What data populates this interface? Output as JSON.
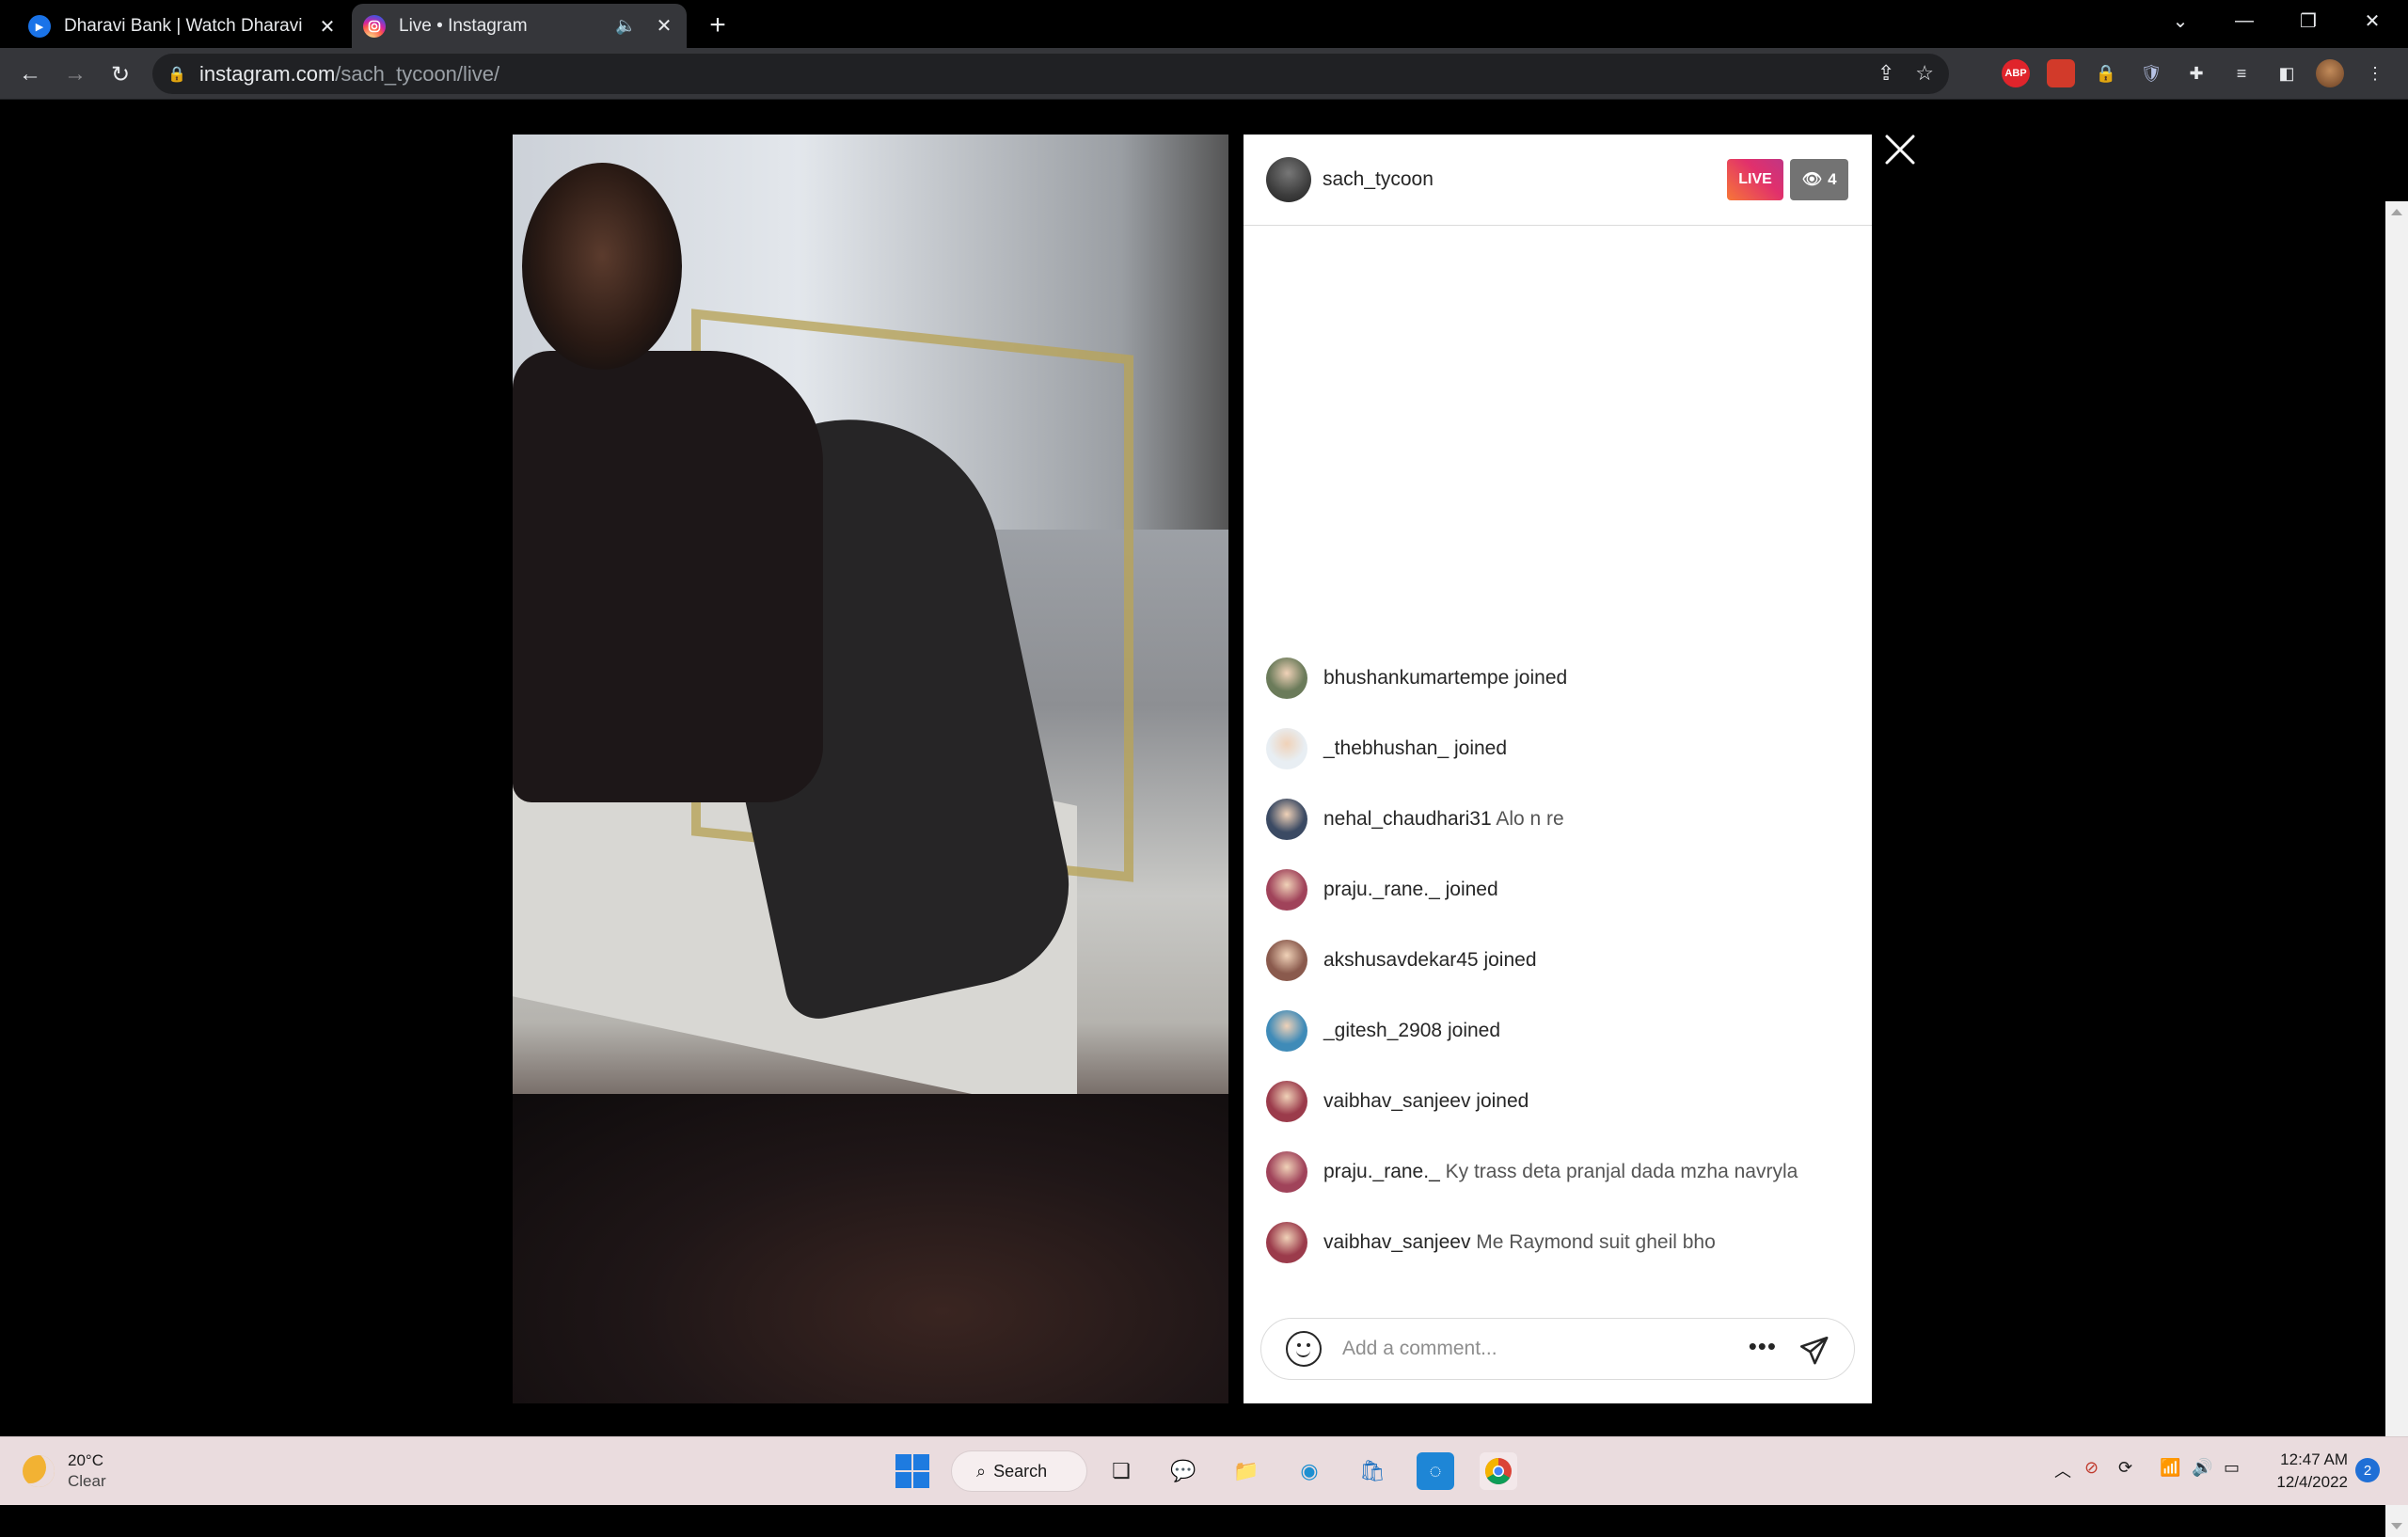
{
  "browser": {
    "tabs": [
      {
        "title": "Dharavi Bank | Watch Dharavi Bank",
        "active": false
      },
      {
        "title": "Live • Instagram",
        "active": true
      }
    ],
    "url_domain": "instagram.com",
    "url_path": "/sach_tycoon/live/"
  },
  "live": {
    "host_username": "sach_tycoon",
    "live_label": "LIVE",
    "viewer_count": "4"
  },
  "comments": [
    {
      "user": "bhushankumartempe",
      "message": "joined",
      "kind": "join",
      "avatar_color": "#6b7b5a"
    },
    {
      "user": "_thebhushan_",
      "message": "joined",
      "kind": "join",
      "avatar_color": "#e8eef3"
    },
    {
      "user": "nehal_chaudhari31",
      "message": "Alo n re",
      "kind": "comment",
      "avatar_color": "#3b4a63"
    },
    {
      "user": "praju._rane._",
      "message": "joined",
      "kind": "join",
      "avatar_color": "#a0435a"
    },
    {
      "user": "akshusavdekar45",
      "message": "joined",
      "kind": "join",
      "avatar_color": "#8a5a4d"
    },
    {
      "user": "_gitesh_2908",
      "message": "joined",
      "kind": "join",
      "avatar_color": "#3f8bb8"
    },
    {
      "user": "vaibhav_sanjeev",
      "message": "joined",
      "kind": "join",
      "avatar_color": "#9b3b4b"
    },
    {
      "user": "praju._rane._",
      "message": "Ky trass deta pranjal dada mzha navryla",
      "kind": "comment",
      "avatar_color": "#a0435a"
    },
    {
      "user": "vaibhav_sanjeev",
      "message": "Me Raymond suit gheil bho",
      "kind": "comment",
      "avatar_color": "#9b3b4b"
    }
  ],
  "comment_box": {
    "placeholder": "Add a comment..."
  },
  "taskbar": {
    "temperature": "20°C",
    "condition": "Clear",
    "search_label": "Search",
    "time": "12:47 AM",
    "date": "12/4/2022",
    "notification_count": "2"
  }
}
